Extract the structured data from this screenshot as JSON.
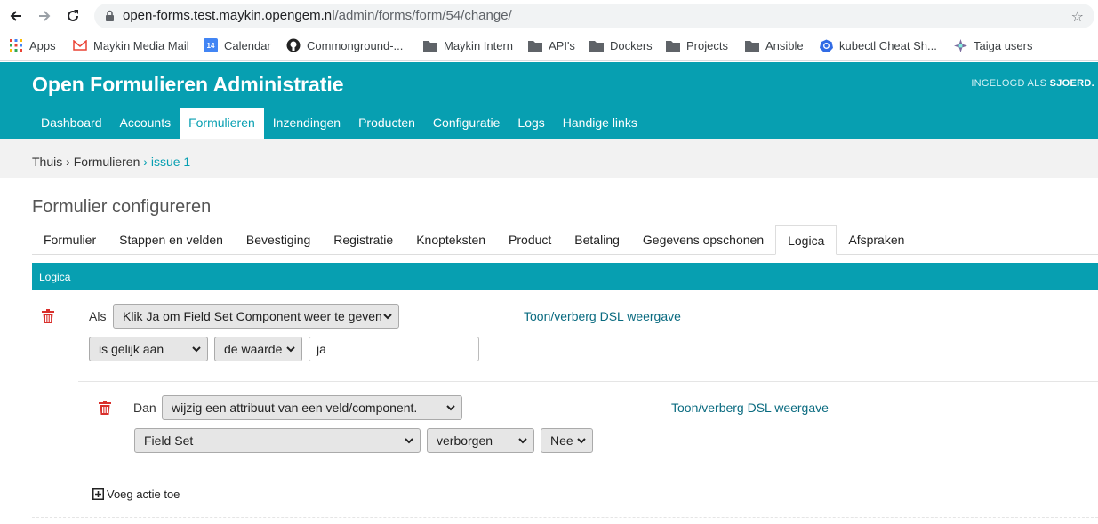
{
  "browser": {
    "url_host": "open-forms.test.maykin.opengem.nl",
    "url_path": "/admin/forms/form/54/change/"
  },
  "bookmarks": [
    {
      "label": "Apps",
      "icon": "apps-grid-icon"
    },
    {
      "label": "Maykin Media Mail",
      "icon": "gmail-icon"
    },
    {
      "label": "Calendar",
      "icon": "calendar-icon",
      "icon_text": "14"
    },
    {
      "label": "Commonground-...",
      "icon": "github-icon"
    },
    {
      "label": "Maykin Intern",
      "icon": "folder-icon"
    },
    {
      "label": "API's",
      "icon": "folder-icon"
    },
    {
      "label": "Dockers",
      "icon": "folder-icon"
    },
    {
      "label": "Projects",
      "icon": "folder-icon"
    },
    {
      "label": "Ansible",
      "icon": "folder-icon"
    },
    {
      "label": "kubectl Cheat Sh...",
      "icon": "kubernetes-icon"
    },
    {
      "label": "Taiga users",
      "icon": "taiga-icon"
    }
  ],
  "header": {
    "site_title": "Open Formulieren Administratie",
    "user_prefix": "INGELOGD ALS",
    "username": "SJOERD."
  },
  "mainnav": [
    "Dashboard",
    "Accounts",
    "Formulieren",
    "Inzendingen",
    "Producten",
    "Configuratie",
    "Logs",
    "Handige links"
  ],
  "breadcrumb": {
    "home": "Thuis",
    "sep1": " › ",
    "section": "Formulieren",
    "current": " › issue 1"
  },
  "page_title": "Formulier configureren",
  "tabs": [
    "Formulier",
    "Stappen en velden",
    "Bevestiging",
    "Registratie",
    "Knopteksten",
    "Product",
    "Betaling",
    "Gegevens opschonen",
    "Logica",
    "Afspraken"
  ],
  "module_title": "Logica",
  "rule": {
    "if_label": "Als",
    "trigger_field": "Klik Ja om Field Set Component weer te geven",
    "operator": "is gelijk aan",
    "compare_type": "de waarde",
    "compare_value": "ja",
    "dsl_toggle": "Toon/verberg DSL weergave",
    "action": {
      "then_label": "Dan",
      "action_type": "wijzig een attribuut van een veld/component.",
      "component": "Field Set",
      "attribute": "verborgen",
      "value": "Nee",
      "dsl_toggle": "Toon/verberg DSL weergave"
    },
    "add_action": "Voeg actie toe"
  },
  "colors": {
    "brand": "#079fb1",
    "link": "#0a6b80",
    "danger": "#d9302c"
  }
}
